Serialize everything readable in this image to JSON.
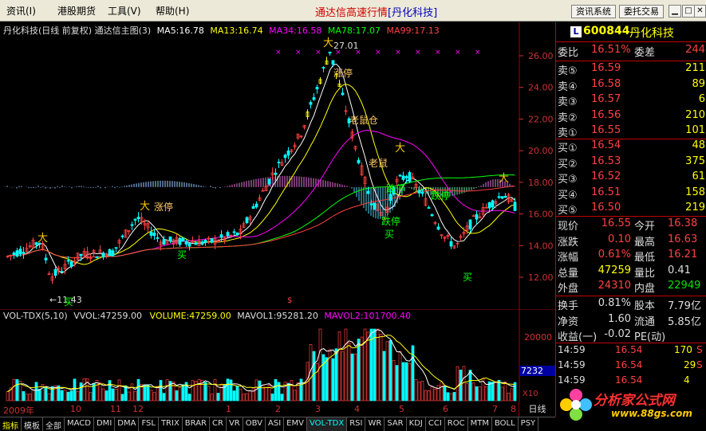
{
  "menu": {
    "items": [
      "资讯(I)",
      "港股期货",
      "工具(V)",
      "帮助(H)"
    ],
    "title_prefix": "通达信高速行情",
    "title_stock": "[丹化科技]",
    "btn_news": "资讯系统",
    "btn_trade": "委托交易"
  },
  "chart": {
    "header_name": "丹化科技(日线 前复权) 通达信主图(3)",
    "ma5": "MA5:16.78",
    "ma13": "MA13:16.74",
    "ma34": "MA34:16.58",
    "ma78": "MA78:17.07",
    "ma99": "MA99:17.13",
    "price_axis": [
      "26.00",
      "24.00",
      "22.00",
      "20.00",
      "18.00",
      "16.00",
      "14.00",
      "12.00"
    ],
    "max_label": "27.01",
    "min_label": "11.43",
    "annotations": {
      "limit_up_1": "涨停",
      "limit_up_2": "涨停",
      "rat_1": "老鼠仓",
      "rat_2": "老鼠",
      "limit_down_1": "跌停",
      "limit_down_2": "跌停",
      "limit_down_3": "跌停",
      "buy_1": "买",
      "buy_2": "买",
      "buy_3": "买",
      "buy_4": "买"
    }
  },
  "volume": {
    "header_name": "VOL-TDX(5,10)",
    "vvol": "VVOL:47259.00",
    "volume": "VOLUME:47259.00",
    "mavol1": "MAVOL1:95281.20",
    "mavol2": "MAVOL2:101700.40",
    "axis_label": "20000",
    "current_label": "7232",
    "unit_label": "X10"
  },
  "date_axis": {
    "labels": [
      "2009年",
      "10",
      "11",
      "12",
      "1",
      "2",
      "3",
      "4",
      "5",
      "6",
      "7",
      "8"
    ],
    "period": "日线"
  },
  "tabs": [
    "指标",
    "模板",
    "全部",
    "MACD",
    "DMI",
    "DMA",
    "FSL",
    "TRIX",
    "BRAR",
    "CR",
    "VR",
    "OBV",
    "ASI",
    "EMV",
    "VOL-TDX",
    "RSI",
    "WR",
    "SAR",
    "KDJ",
    "CCI",
    "ROC",
    "MTM",
    "BOLL",
    "PSY"
  ],
  "quote": {
    "badge": "L",
    "code": "600844",
    "name": "丹化科技",
    "weibi_label": "委比",
    "weibi_value": "16.51%",
    "weicha_label": "委差",
    "weicha_value": "244",
    "asks": [
      {
        "label": "卖⑤",
        "price": "16.59",
        "vol": "211"
      },
      {
        "label": "卖④",
        "price": "16.58",
        "vol": "89"
      },
      {
        "label": "卖③",
        "price": "16.57",
        "vol": "6"
      },
      {
        "label": "卖②",
        "price": "16.56",
        "vol": "210"
      },
      {
        "label": "卖①",
        "price": "16.55",
        "vol": "101"
      }
    ],
    "bids": [
      {
        "label": "买①",
        "price": "16.54",
        "vol": "48"
      },
      {
        "label": "买②",
        "price": "16.53",
        "vol": "375"
      },
      {
        "label": "买③",
        "price": "16.52",
        "vol": "61"
      },
      {
        "label": "买④",
        "price": "16.51",
        "vol": "158"
      },
      {
        "label": "买⑤",
        "price": "16.50",
        "vol": "219"
      }
    ],
    "stats": [
      {
        "l1": "现价",
        "v1": "16.55",
        "l2": "今开",
        "v2": "16.38"
      },
      {
        "l1": "涨跌",
        "v1": "0.10",
        "l2": "最高",
        "v2": "16.63"
      },
      {
        "l1": "涨幅",
        "v1": "0.61%",
        "l2": "最低",
        "v2": "16.21"
      },
      {
        "l1": "总量",
        "v1": "47259",
        "l2": "量比",
        "v2": "0.41"
      },
      {
        "l1": "外盘",
        "v1": "24310",
        "l2": "内盘",
        "v2": "22949"
      }
    ],
    "stats2": [
      {
        "l1": "换手",
        "v1": "0.81%",
        "l2": "股本",
        "v2": "7.79亿"
      },
      {
        "l1": "净资",
        "v1": "1.60",
        "l2": "流通",
        "v2": "5.85亿"
      },
      {
        "l1": "收益(一)",
        "v1": "-0.02",
        "l2": "PE(动)",
        "v2": ""
      }
    ],
    "ticks": [
      {
        "time": "14:59",
        "price": "16.54",
        "vol": "170",
        "dir": "S"
      },
      {
        "time": "14:59",
        "price": "16.54",
        "vol": "29",
        "dir": "S"
      },
      {
        "time": "14:59",
        "price": "16.54",
        "vol": "4",
        "dir": ""
      }
    ]
  },
  "watermark": {
    "title": "分析家公式网",
    "url": "www.88gs.com"
  },
  "colors": {
    "up": "#ff4040",
    "down": "#00e000",
    "ma5": "#ffffff",
    "ma13": "#ffff00",
    "ma34": "#ff00ff",
    "ma78": "#00ff00",
    "ma99": "#ff4040"
  }
}
